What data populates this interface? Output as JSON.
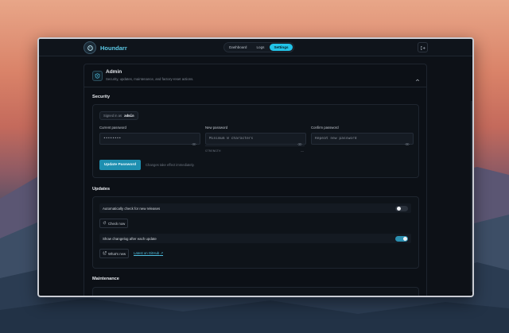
{
  "app": {
    "name": "Houndarr"
  },
  "nav": [
    {
      "label": "Dashboard",
      "active": false
    },
    {
      "label": "Logs",
      "active": false
    },
    {
      "label": "Settings",
      "active": true
    }
  ],
  "admin": {
    "title": "Admin",
    "subtitle": "Security, updates, maintenance, and factory-reset actions."
  },
  "security": {
    "title": "Security",
    "signed_in_label": "Signed in as",
    "username": "admin",
    "current_password": {
      "label": "Current password",
      "value": "••••••••"
    },
    "new_password": {
      "label": "New password",
      "placeholder": "Minimum 8 characters",
      "strength_label": "STRENGTH",
      "strength_value": "—"
    },
    "confirm_password": {
      "label": "Confirm password",
      "placeholder": "Repeat new password"
    },
    "update_button": "Update Password",
    "hint": "Changes take effect immediately."
  },
  "updates": {
    "title": "Updates",
    "auto_check": {
      "label": "Automatically check for new releases",
      "enabled": false
    },
    "check_now": "Check now",
    "changelog": {
      "label": "Show changelog after each update",
      "enabled": true
    },
    "whats_new": "What's new",
    "github_link": "Latest on GitHub"
  },
  "maintenance": {
    "title": "Maintenance"
  },
  "colors": {
    "accent": "#22c3e8",
    "primary_button": "#1e8fb0",
    "toggle_on": "#2b8fb0",
    "toggle_off": "#2a313b"
  }
}
